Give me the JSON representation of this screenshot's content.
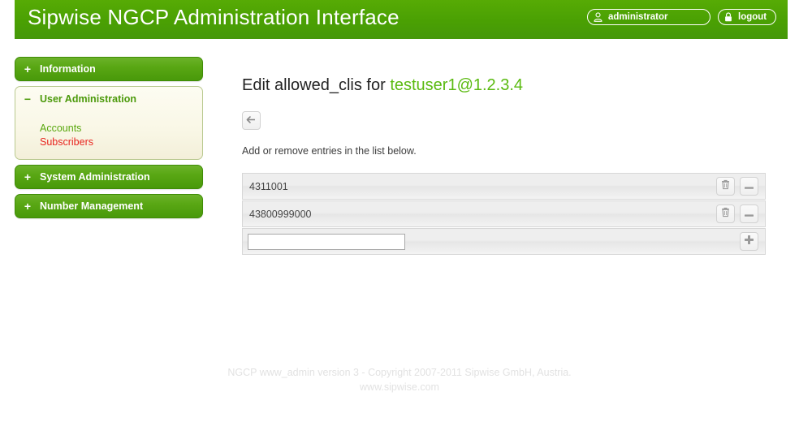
{
  "header": {
    "title": "Sipwise NGCP Administration Interface",
    "user_button": {
      "label": "administrator",
      "icon": "user-icon"
    },
    "logout_button": {
      "label": "logout",
      "icon": "lock-icon"
    },
    "background_color": "#4aa003"
  },
  "sidebar": {
    "items": [
      {
        "label": "Information",
        "sign": "+",
        "expanded": false
      },
      {
        "label": "User Administration",
        "sign": "−",
        "expanded": true,
        "children": [
          {
            "label": "Accounts",
            "state": "normal"
          },
          {
            "label": "Subscribers",
            "state": "active"
          }
        ]
      },
      {
        "label": "System Administration",
        "sign": "+",
        "expanded": false
      },
      {
        "label": "Number Management",
        "sign": "+",
        "expanded": false
      }
    ],
    "colors": {
      "button_green": "#59a714",
      "panel_cream": "#f9f7e6",
      "link_green": "#5aa80f",
      "link_active_red": "#e8241e"
    }
  },
  "main": {
    "title_prefix": "Edit allowed_clis for ",
    "title_subject": "testuser1@1.2.3.4",
    "back_button": {
      "label": "←",
      "icon": "arrow-left-icon"
    },
    "hint": "Add or remove entries in the list below.",
    "list": {
      "entries": [
        {
          "value": "4311001",
          "delete_icon": "trash-icon",
          "remove_icon": "minus-icon"
        },
        {
          "value": "43800999000",
          "delete_icon": "trash-icon",
          "remove_icon": "minus-icon"
        }
      ],
      "new_entry": {
        "value": "",
        "placeholder": "",
        "add_icon": "plus-icon"
      }
    }
  },
  "footer": {
    "line1": "NGCP www_admin version 3 - Copyright 2007-2011 Sipwise GmbH, Austria.",
    "line2": "www.sipwise.com"
  }
}
